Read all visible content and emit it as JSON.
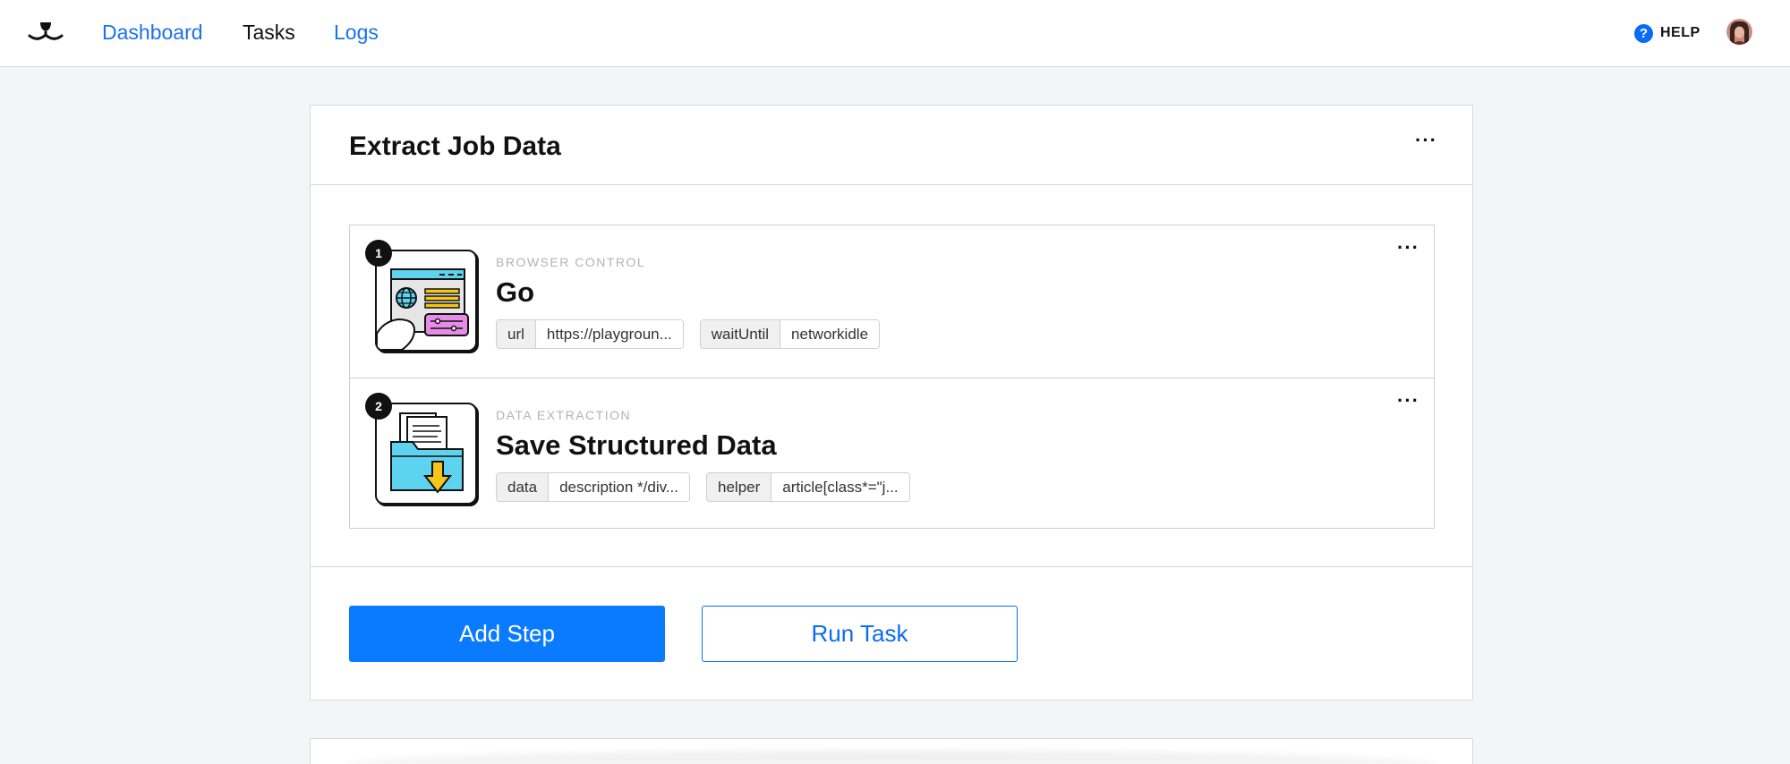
{
  "nav": {
    "links": [
      {
        "label": "Dashboard",
        "active": false
      },
      {
        "label": "Tasks",
        "active": true
      },
      {
        "label": "Logs",
        "active": false
      }
    ],
    "help_label": "HELP",
    "help_glyph": "?"
  },
  "task": {
    "title": "Extract Job Data",
    "menu_glyph": "···",
    "steps": [
      {
        "number": "1",
        "category": "BROWSER CONTROL",
        "title": "Go",
        "icon": "browser-control-icon",
        "params": [
          {
            "key": "url",
            "value": "https://playgroun..."
          },
          {
            "key": "waitUntil",
            "value": "networkidle"
          }
        ]
      },
      {
        "number": "2",
        "category": "DATA EXTRACTION",
        "title": "Save Structured Data",
        "icon": "data-extraction-icon",
        "params": [
          {
            "key": "data",
            "value": "description */div..."
          },
          {
            "key": "helper",
            "value": "article[class*=\"j..."
          }
        ]
      }
    ],
    "add_step_label": "Add Step",
    "run_task_label": "Run Task"
  },
  "colors": {
    "accent": "#0a7bff",
    "link": "#1a73e8",
    "background": "#f4f5f7"
  }
}
